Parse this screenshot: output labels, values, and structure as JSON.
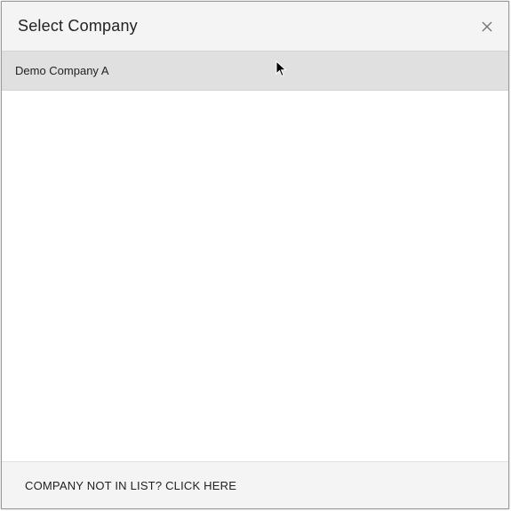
{
  "dialog": {
    "title": "Select Company",
    "close_icon": "close-icon"
  },
  "companies": [
    {
      "name": "Demo Company A",
      "selected": true
    }
  ],
  "footer": {
    "link_label": "COMPANY NOT IN LIST? CLICK HERE"
  },
  "colors": {
    "header_bg": "#f4f4f4",
    "selected_row_bg": "#e0e0e0",
    "text": "#222222"
  }
}
